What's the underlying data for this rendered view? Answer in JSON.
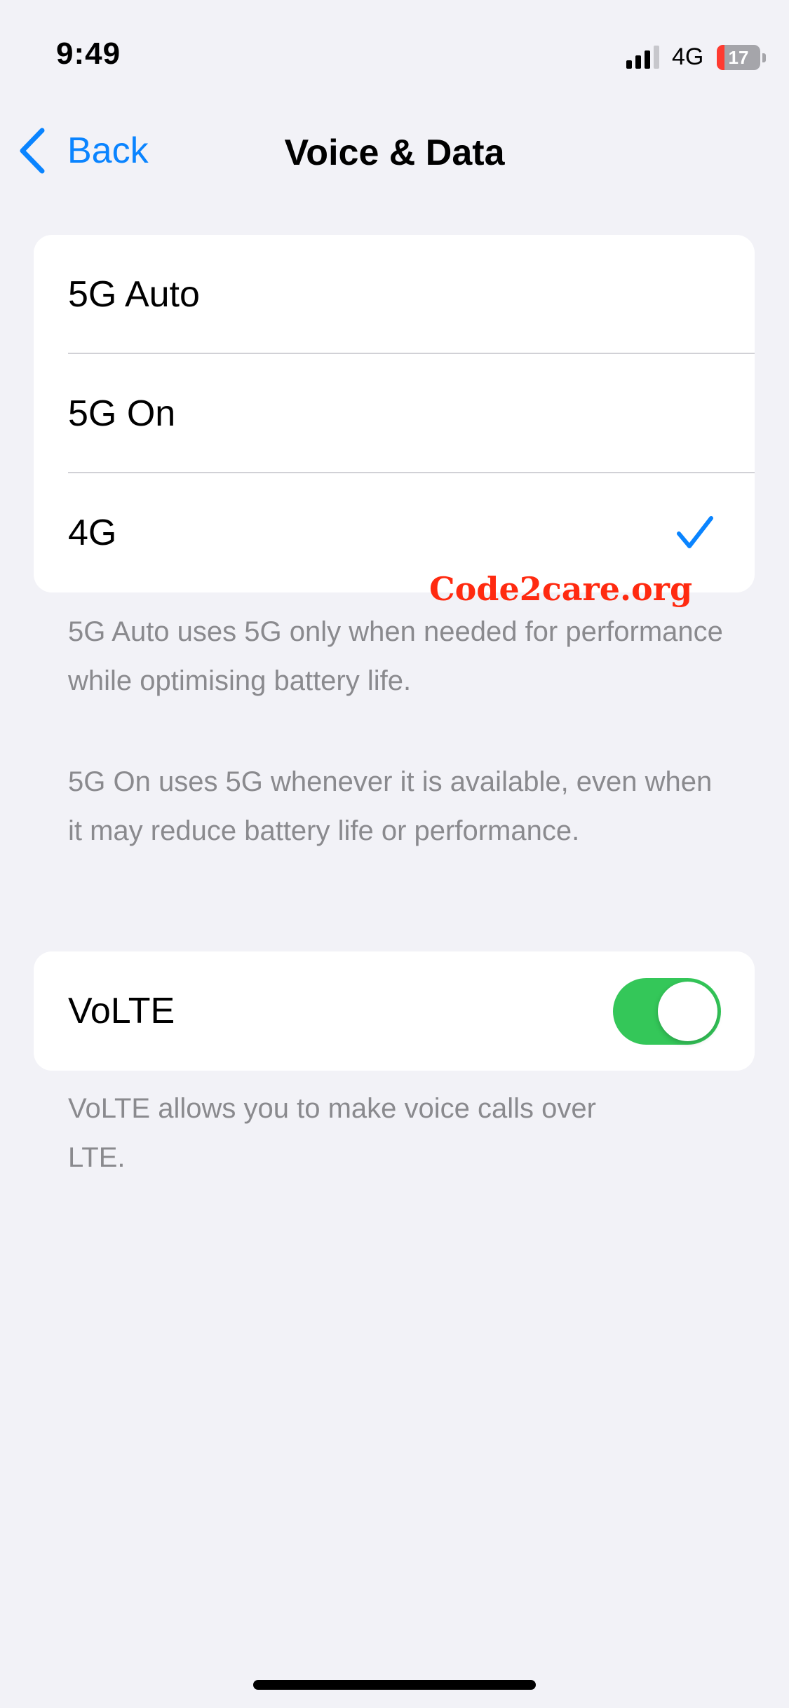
{
  "status_bar": {
    "time": "9:49",
    "network": "4G",
    "battery_level": "17",
    "battery_fraction": 0.17,
    "icons": [
      "cellular-signal-icon",
      "battery-icon"
    ]
  },
  "nav": {
    "back_label": "Back",
    "title": "Voice & Data",
    "icons": [
      "chevron-left-icon"
    ]
  },
  "options": [
    {
      "label": "5G Auto",
      "selected": false
    },
    {
      "label": "5G On",
      "selected": false
    },
    {
      "label": "4G",
      "selected": true
    }
  ],
  "watermark": "Code2care.org",
  "footer_5g": {
    "auto_text": "5G Auto uses 5G only when needed for performance while optimising battery life.",
    "on_text": "5G On uses 5G whenever it is available, even when it may reduce battery life or performance."
  },
  "volte": {
    "label": "VoLTE",
    "enabled": true,
    "footer": "VoLTE allows you to make voice calls over LTE."
  },
  "colors": {
    "accent": "#0a84ff",
    "toggle_on": "#34c759",
    "background": "#f2f2f7",
    "watermark": "#ff2a10",
    "battery_low": "#ff3b30"
  }
}
